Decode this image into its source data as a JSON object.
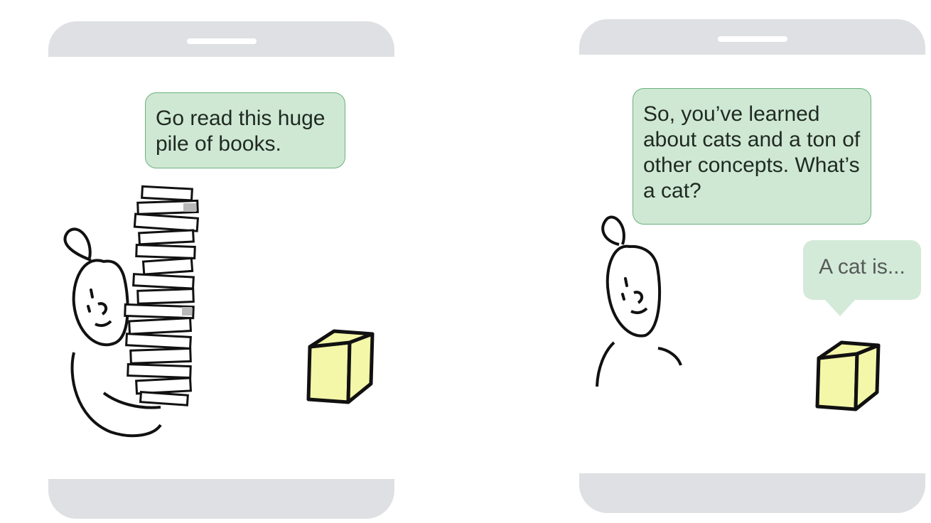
{
  "panel_left": {
    "speech": "Go read this huge pile of books."
  },
  "panel_right": {
    "speech": "So, you’ve learned about cats and a ton of other concepts. What’s a cat?",
    "reply": "A cat is..."
  },
  "colors": {
    "phone_frame": "#dfe0e3",
    "bubble_green": "#cfe8d3",
    "bubble_border": "#6bb07c",
    "cube_yellow": "#f4f7a8",
    "ink": "#111111"
  },
  "icons": [
    "person-icon",
    "book-stack-icon",
    "cube-icon"
  ]
}
